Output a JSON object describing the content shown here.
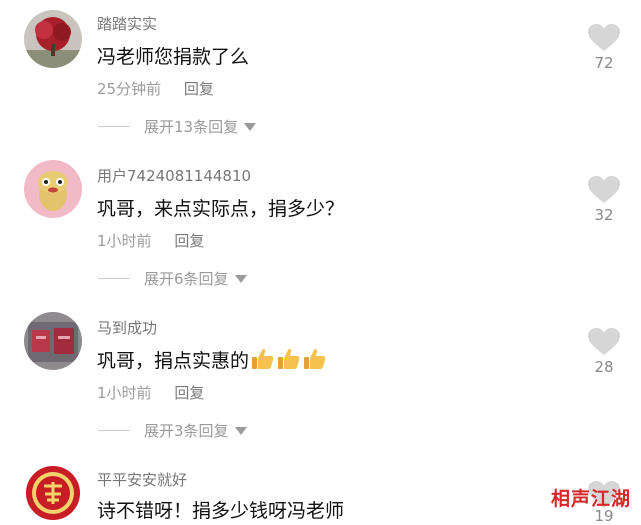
{
  "comments": [
    {
      "username": "踏踏实实",
      "text": "冯老师您捐款了么",
      "time": "25分钟前",
      "reply_label": "回复",
      "likes": "72",
      "expand_label": "展开13条回复"
    },
    {
      "username": "用户7424081144810",
      "text": "巩哥，来点实际点，捐多少？",
      "time": "1小时前",
      "reply_label": "回复",
      "likes": "32",
      "expand_label": "展开6条回复"
    },
    {
      "username": "马到成功",
      "text": "巩哥，捐点实惠的",
      "emoji": "thumbs-up-icon x3",
      "time": "1小时前",
      "reply_label": "回复",
      "likes": "28",
      "expand_label": "展开3条回复"
    },
    {
      "username": "平平安安就好",
      "text": "诗不错呀！捐多少钱呀冯老师",
      "likes": "19"
    }
  ],
  "watermark": "相声江湖",
  "colors": {
    "heart": "#d6d6d6",
    "watermark": "#d7282a"
  }
}
